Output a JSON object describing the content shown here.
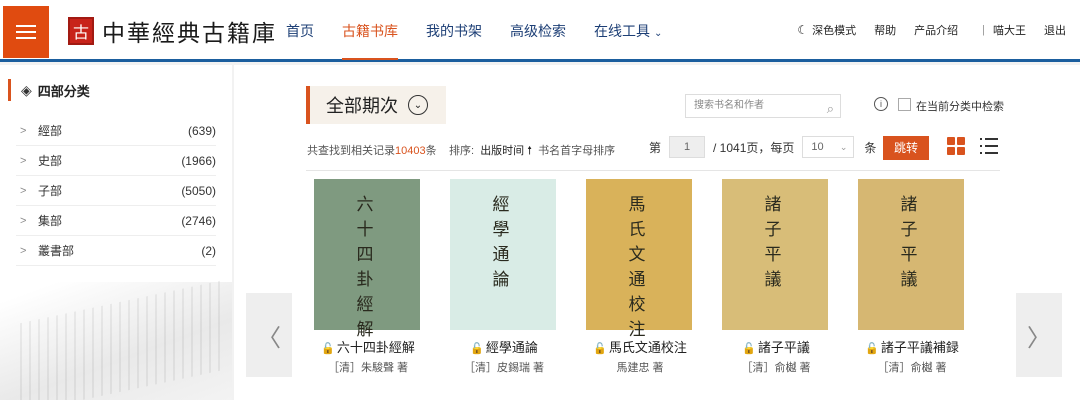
{
  "header": {
    "logo_seal": "古",
    "logo_text": "中華經典古籍庫",
    "nav": [
      {
        "label": "首页",
        "active": false
      },
      {
        "label": "古籍书库",
        "active": true
      },
      {
        "label": "我的书架",
        "active": false
      },
      {
        "label": "高级检索",
        "active": false
      },
      {
        "label": "在线工具",
        "active": false,
        "has_dropdown": true
      }
    ],
    "dark_mode": "深色模式",
    "help": "帮助",
    "product": "产品介绍",
    "separator": "|",
    "user": "喵大王",
    "logout": "退出"
  },
  "sidebar": {
    "title": "四部分类",
    "items": [
      {
        "label": "經部",
        "count": "(639)"
      },
      {
        "label": "史部",
        "count": "(1966)"
      },
      {
        "label": "子部",
        "count": "(5050)"
      },
      {
        "label": "集部",
        "count": "(2746)"
      },
      {
        "label": "叢書部",
        "count": "(2)"
      }
    ]
  },
  "main": {
    "period_title": "全部期次",
    "search_placeholder": "搜索书名和作者",
    "search_in_category": "在当前分类中检索",
    "stats_prefix": "共查找到相关记录",
    "stats_count": "10403",
    "stats_suffix": "条",
    "sort_label": "排序:",
    "sort_by_date": "出版时间",
    "sort_by_title": "书名首字母排序",
    "pager_prefix": "第",
    "current_page": "1",
    "pager_total": "/ 1041页，每页",
    "page_size": "10",
    "per_suffix": "条",
    "go_button": "跳转"
  },
  "books": [
    {
      "title": "六十四卦經解",
      "author": "［清］朱駿聲 著",
      "cover_text": "六十四卦經解",
      "cover_color": "#7f9a80"
    },
    {
      "title": "經學通論",
      "author": "［清］皮錫瑞 著",
      "cover_text": "經學通論",
      "cover_color": "#d9ece6"
    },
    {
      "title": "馬氏文通校注",
      "author": "馬建忠 著",
      "cover_text": "馬氏文通校注",
      "cover_color": "#d9b25a"
    },
    {
      "title": "諸子平議",
      "author": "［清］俞樾 著",
      "cover_text": "諸子平議",
      "cover_color": "#d8bd78"
    },
    {
      "title": "諸子平議補録",
      "author": "［清］俞樾 著",
      "cover_text": "諸子平議",
      "cover_color": "#d6b772"
    }
  ],
  "colors": {
    "accent": "#d9531e",
    "nav": "#1d3f76",
    "header_rule": "#1b5e9e"
  }
}
